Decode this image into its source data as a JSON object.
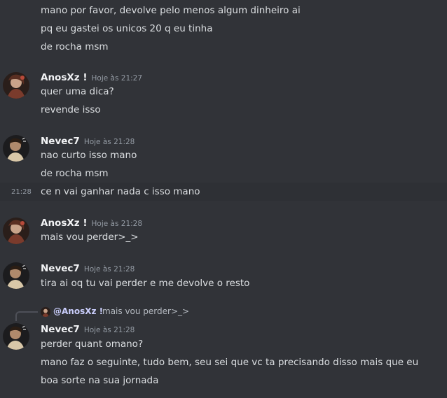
{
  "messages_top": {
    "lines": [
      "mano por favor, devolve pelo menos algum dinheiro ai",
      "pq eu gastei os unicos 20 q eu tinha",
      "de rocha msm"
    ]
  },
  "group1": {
    "author": "AnosXz !",
    "time": "Hoje às 21:27",
    "lines": [
      "quer uma dica?",
      "revende isso"
    ]
  },
  "group2": {
    "author": "Nevec7",
    "time": "Hoje às 21:28",
    "lines": [
      "nao curto isso mano",
      "de rocha msm"
    ],
    "hover_time": "21:28",
    "hover_line": "ce n vai ganhar nada c isso mano"
  },
  "group3": {
    "author": "AnosXz !",
    "time": "Hoje às 21:28",
    "lines": [
      "mais vou perder>_>"
    ]
  },
  "group4": {
    "author": "Nevec7",
    "time": "Hoje às 21:28",
    "lines": [
      "tira ai oq tu vai perder e me devolve o resto"
    ]
  },
  "group5": {
    "reply_author": "@AnosXz !",
    "reply_text": "mais vou perder>_>",
    "author": "Nevec7",
    "time": "Hoje às 21:28",
    "lines": [
      "perder quant omano?",
      "mano faz o seguinte, tudo bem, seu sei que vc ta precisando disso mais que eu",
      "boa sorte na sua jornada"
    ]
  },
  "colors": {
    "background": "#313338",
    "hover_background": "#2e3035",
    "text": "#dbdee1",
    "timestamp": "#949ba4",
    "author": "#f2f3f5"
  },
  "icons": {
    "anosxz_avatar": "avatar-anosxz",
    "nevec7_avatar": "avatar-nevec7"
  }
}
